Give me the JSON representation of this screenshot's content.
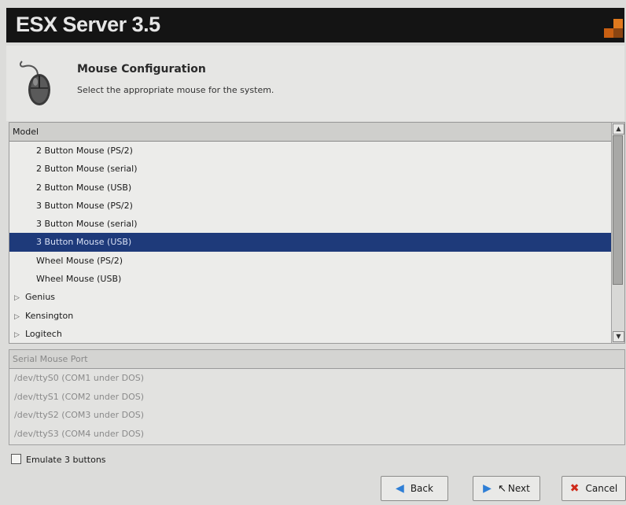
{
  "banner": {
    "brand": "ESX Server 3.5"
  },
  "header": {
    "title": "Mouse Configuration",
    "subtitle": "Select the appropriate mouse for the system."
  },
  "model_list": {
    "column_header": "Model",
    "items": [
      {
        "label": "2 Button Mouse (PS/2)",
        "type": "item",
        "selected": false
      },
      {
        "label": "2 Button Mouse (serial)",
        "type": "item",
        "selected": false
      },
      {
        "label": "2 Button Mouse (USB)",
        "type": "item",
        "selected": false
      },
      {
        "label": "3 Button Mouse (PS/2)",
        "type": "item",
        "selected": false
      },
      {
        "label": "3 Button Mouse (serial)",
        "type": "item",
        "selected": false
      },
      {
        "label": "3 Button Mouse (USB)",
        "type": "item",
        "selected": true
      },
      {
        "label": "Wheel Mouse (PS/2)",
        "type": "item",
        "selected": false
      },
      {
        "label": "Wheel Mouse (USB)",
        "type": "item",
        "selected": false
      },
      {
        "label": "Genius",
        "type": "group",
        "selected": false
      },
      {
        "label": "Kensington",
        "type": "group",
        "selected": false
      },
      {
        "label": "Logitech",
        "type": "group",
        "selected": false
      }
    ]
  },
  "serial_list": {
    "column_header": "Serial Mouse Port",
    "items": [
      "/dev/ttyS0 (COM1 under DOS)",
      "/dev/ttyS1 (COM2 under DOS)",
      "/dev/ttyS2 (COM3 under DOS)",
      "/dev/ttyS3 (COM4 under DOS)"
    ]
  },
  "emulate": {
    "label": "Emulate 3 buttons",
    "checked": false
  },
  "buttons": {
    "back": "Back",
    "next": "Next",
    "cancel": "Cancel"
  },
  "icons": {
    "mouse": "mouse-icon",
    "back": "arrow-left-icon",
    "next": "arrow-right-icon",
    "cancel": "x-icon"
  }
}
